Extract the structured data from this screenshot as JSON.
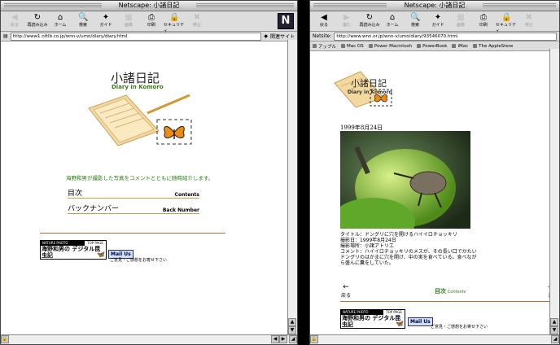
{
  "left": {
    "title": "Netscape: 小諸日記",
    "toolbar": [
      {
        "label": "戻る",
        "icon": "◀",
        "disabled": true
      },
      {
        "label": "再読み込み",
        "icon": "↻",
        "disabled": false
      },
      {
        "label": "ホーム",
        "icon": "⌂",
        "disabled": false
      },
      {
        "label": "検索",
        "icon": "🔍",
        "disabled": false
      },
      {
        "label": "ガイド",
        "icon": "✦",
        "disabled": false
      },
      {
        "label": "画像",
        "icon": "▦",
        "disabled": true
      },
      {
        "label": "印刷",
        "icon": "⎙",
        "disabled": false
      },
      {
        "label": "セキュリティ",
        "icon": "🔒",
        "disabled": false
      },
      {
        "label": "停止",
        "icon": "✖",
        "disabled": true
      }
    ],
    "location_url": "http://www1.nttlb.co.jp/wnn-v/umo/diary/diary.html",
    "related_label": "関連サイト",
    "page": {
      "title_jp": "小諸日記",
      "title_en": "Diary in Komoro",
      "intro": "海野和男が撮影した写真をコメントとともに随時紹介します。",
      "menu": [
        {
          "jp": "目次",
          "en": "Contents"
        },
        {
          "jp": "バックナンバー",
          "en": "Back Number"
        }
      ],
      "banner_top": "NATURE PHOTO",
      "banner_page": "TOP PAGE",
      "banner_title": "海野和男の デジタル昆虫記",
      "mail_button": "Mail Us",
      "mail_note": "ご意見・ご感想をお寄せ下さい"
    }
  },
  "right": {
    "title": "Netscape: 小諸日記",
    "toolbar": [
      {
        "label": "戻る",
        "icon": "◀",
        "disabled": false
      },
      {
        "label": "進む",
        "icon": "▶",
        "disabled": true
      },
      {
        "label": "再読み込み",
        "icon": "↻",
        "disabled": false
      },
      {
        "label": "ホーム",
        "icon": "⌂",
        "disabled": false
      },
      {
        "label": "検索",
        "icon": "🔍",
        "disabled": false
      },
      {
        "label": "ガイド",
        "icon": "✦",
        "disabled": false
      },
      {
        "label": "画像",
        "icon": "▦",
        "disabled": true
      },
      {
        "label": "印刷",
        "icon": "⎙",
        "disabled": false
      },
      {
        "label": "セキュリティ",
        "icon": "🔒",
        "disabled": false
      },
      {
        "label": "停止",
        "icon": "✖",
        "disabled": true
      }
    ],
    "location_label": "Netsite:",
    "location_url": "http://www.wnn.or.jp/wnn-v/umo/diary/93546070.html",
    "personal": [
      "アップル",
      "Mac OS",
      "Power Macintosh",
      "PowerBook",
      "iMac",
      "The AppleStore"
    ],
    "page": {
      "title_jp": "小諸日記",
      "title_en": "Diary in Komoro",
      "date": "1999年8月24日",
      "info": [
        "タイトル：ドングリに穴を開けるハイイロチョッキリ",
        "撮影日：1999年8月24日",
        "撮影場所：小諸アトリエ",
        "コメント：ハイイロチョッキリのメスが、その長い口でかたいドングリのはかまに穴を開け、中の実を食べている。食べながら盛んに糞をしていた。"
      ],
      "nav_back": "戻る",
      "nav_contents_jp": "目次",
      "nav_contents_en": "Contents",
      "nav_next": "進",
      "banner_top": "NATURE PHOTO",
      "banner_page": "TOP PAGE",
      "banner_title": "海野和男の デジタル昆虫記",
      "mail_button": "Mail Us",
      "mail_note": "ご意見・ご感想をお寄せ下さい"
    }
  }
}
